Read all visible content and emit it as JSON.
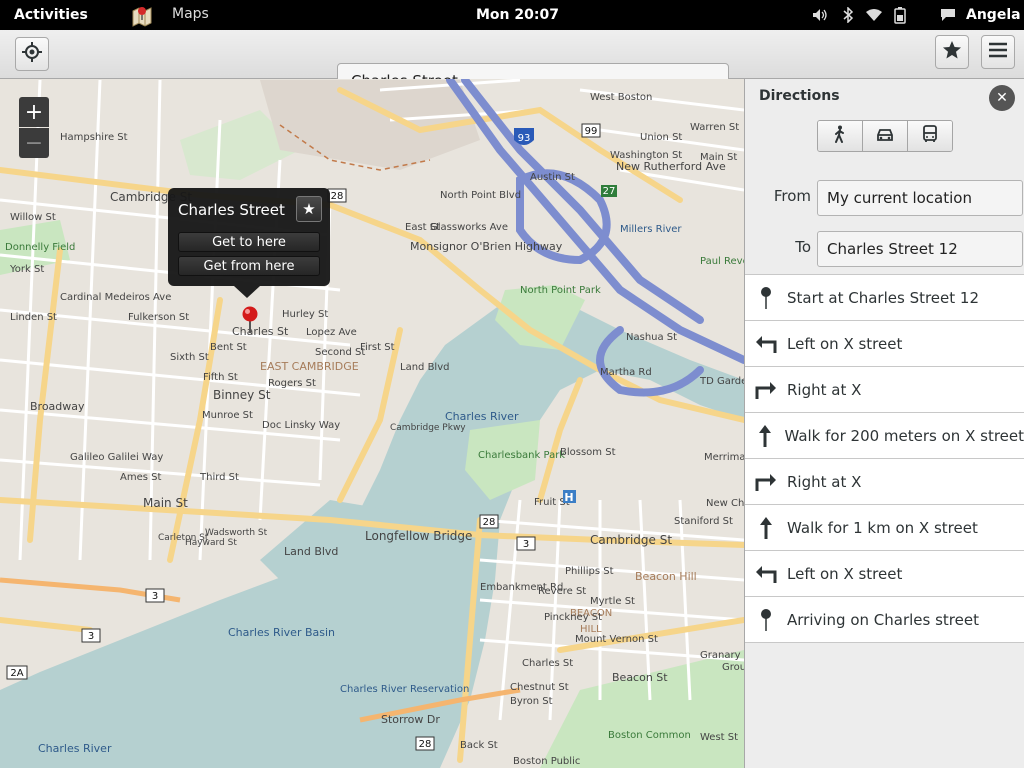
{
  "topbar": {
    "activities": "Activities",
    "app_name": "Maps",
    "clock": "Mon 20:07",
    "user": "Angela"
  },
  "header": {
    "search_value": "Charles Street"
  },
  "popover": {
    "title": "Charles Street",
    "get_to": "Get to here",
    "get_from": "Get from here"
  },
  "zoom": {
    "in": "+",
    "out": "−"
  },
  "sidebar": {
    "title": "Directions",
    "modes": [
      "walking-icon",
      "car-icon",
      "bus-icon"
    ],
    "from_label": "From",
    "from_value": "My current location",
    "to_label": "To",
    "to_value": "Charles Street 12",
    "steps": [
      {
        "icon": "pin-icon",
        "text": "Start at Charles Street 12"
      },
      {
        "icon": "turn-left-icon",
        "text": "Left on X street"
      },
      {
        "icon": "turn-right-icon",
        "text": "Right at X"
      },
      {
        "icon": "straight-icon",
        "text": "Walk for 200 meters on X street"
      },
      {
        "icon": "turn-right-icon",
        "text": "Right at X"
      },
      {
        "icon": "straight-icon",
        "text": "Walk for 1 km on X street"
      },
      {
        "icon": "turn-left-icon",
        "text": "Left on X street"
      },
      {
        "icon": "pin-icon",
        "text": "Arriving on Charles street"
      }
    ]
  },
  "map_labels": {
    "charles_street": "Charles St",
    "binney": "Binney St",
    "east_cambridge": "EAST CAMBRIDGE",
    "land_blvd": "Land Blvd",
    "charles_river": "Charles River",
    "charles_river_basin": "Charles River Basin",
    "longfellow": "Longfellow Bridge",
    "cambridge_st": "Cambridge St",
    "main_st": "Main St",
    "broadway": "Broadway",
    "north_point_park": "North Point Park",
    "monsignor": "Monsignor O'Brien Highway",
    "beacon_hill": "Beacon Hill",
    "beacon_st": "Beacon St",
    "storrow": "Storrow Dr",
    "boston_common": "Boston Common",
    "paul_revere": "Paul Revere Park",
    "charlesbank": "Charlesbank Park",
    "reservation": "Charles River Reservation",
    "fruit_st": "Fruit St",
    "martha_rd": "Martha Rd",
    "nashua": "Nashua St",
    "new_rutherford": "New Rutherford Ave",
    "rogers": "Rogers St",
    "first_st": "First St",
    "third_st": "Third St",
    "ames": "Ames St",
    "galileo": "Galileo Galilei Way",
    "cambridge_pkwy": "Cambridge Pkwy",
    "donnelly": "Donnelly Field",
    "i93": "93",
    "r28": "28",
    "r3": "3",
    "r2a": "2A",
    "r99": "99",
    "r27": "27",
    "hurley": "Hurley St",
    "bent": "Bent St",
    "munroe": "Munroe St",
    "doc_linsky": "Doc Linsky Way",
    "west_boston": "West Boston",
    "north_point_blvd": "North Point Blvd",
    "glassworks": "Glassworks Ave",
    "austin": "Austin St",
    "washington": "Washington St",
    "union": "Union St",
    "warren": "Warren St",
    "main_st_ch": "Main St",
    "millers_river": "Millers River",
    "td_garden": "TD Garden",
    "merrimac": "Merrimac",
    "new_chardon": "New Chard",
    "blossom": "Blossom St",
    "staniford": "Staniford St",
    "embankment": "Embankment Rd",
    "charles_st_boston": "Charles St",
    "phillips": "Phillips St",
    "revere": "Revere St",
    "pinckney": "Pinckney St",
    "myrtle": "Myrtle St",
    "mount_vernon": "Mount Vernon St",
    "chestnut": "Chestnut St",
    "byron": "Byron St",
    "back_st": "Back St",
    "beacon_caps": "BEACON",
    "hill_caps": "HILL",
    "granary": "Granary Bu",
    "grou": "Grou",
    "west_st": "West St",
    "boston_public": "Boston Public",
    "cambridge_st_w": "Cambridge St",
    "sixth": "Sixth St",
    "fifth": "Fifth St",
    "fulkerson": "Fulkerson St",
    "cardinal": "Cardinal Medeiros Ave",
    "york": "York St",
    "willow": "Willow St",
    "hampshire": "Hampshire St",
    "second": "Second St",
    "lopez": "Lopez Ave",
    "wadsworth": "Wadsworth St",
    "carleton": "Carleton St",
    "hayward": "Hayward St",
    "linden": "Linden St",
    "east_st": "East St"
  }
}
